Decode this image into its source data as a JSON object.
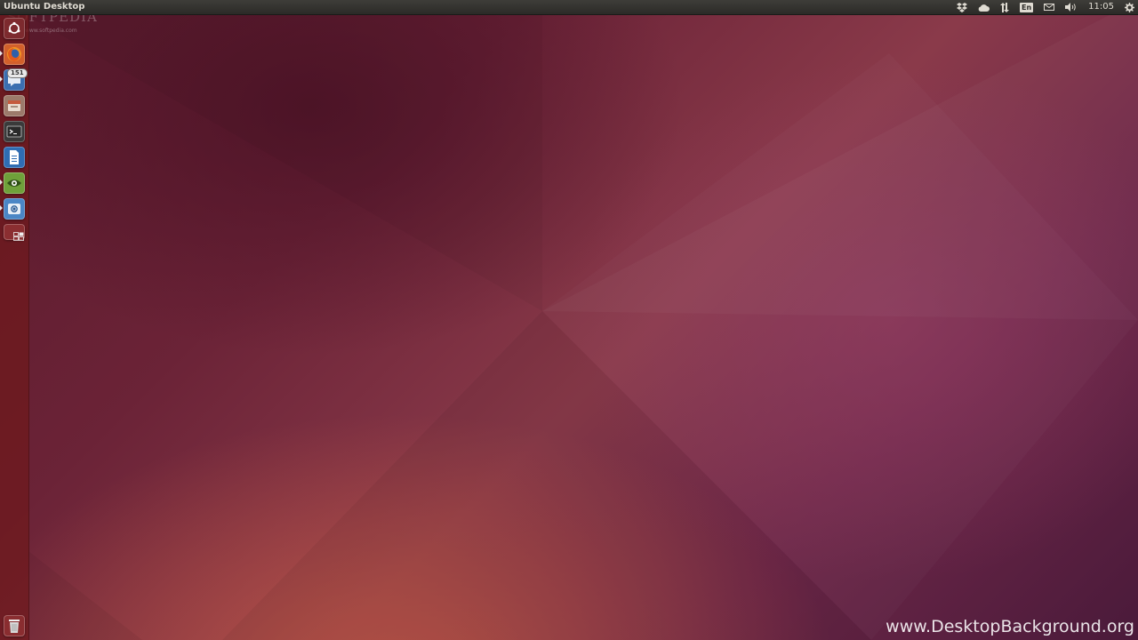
{
  "panel": {
    "app_title": "Ubuntu Desktop",
    "keyboard_layout": "En",
    "clock": "11:05",
    "indicator_icons": [
      "dropbox-icon",
      "cloud-icon",
      "network-icon",
      "keyboard-layout-indicator",
      "mail-icon",
      "volume-icon",
      "session-gear-icon"
    ]
  },
  "launcher": {
    "items": [
      {
        "name": "dash-home",
        "icon": "ubuntu-logo-icon",
        "running": false
      },
      {
        "name": "firefox",
        "icon": "firefox-icon",
        "running": true
      },
      {
        "name": "chat-client",
        "icon": "chat-bubble-icon",
        "running": true,
        "badge": "151"
      },
      {
        "name": "file-manager",
        "icon": "files-icon",
        "running": false
      },
      {
        "name": "terminal",
        "icon": "terminal-icon",
        "running": false
      },
      {
        "name": "text-document",
        "icon": "document-icon",
        "running": false
      },
      {
        "name": "media-viewer",
        "icon": "eye-icon",
        "running": true
      },
      {
        "name": "app-center",
        "icon": "app-center-icon",
        "running": true
      },
      {
        "name": "workspace-switcher",
        "icon": "workspaces-icon",
        "running": false
      },
      {
        "name": "trash",
        "icon": "trash-icon",
        "running": false
      }
    ]
  },
  "watermarks": {
    "softpedia": "SOFTPEDIA",
    "softpedia_url": "www.softpedia.com",
    "site": "www.DesktopBackground.org"
  },
  "colors": {
    "panel_bg": "#2b2a27",
    "launcher_bg": "#6e191e",
    "wallpaper_dark": "#4a1a3a",
    "wallpaper_warm": "#cd5f46"
  }
}
